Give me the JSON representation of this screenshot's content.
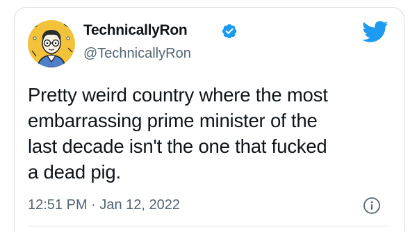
{
  "tweet": {
    "author": {
      "display_name": "TechnicallyRon",
      "handle": "@TechnicallyRon",
      "verified": true,
      "avatar_icon": "cartoon-avatar-icon"
    },
    "text_lines": [
      "Pretty weird country where the most",
      "embarrassing prime minister of the",
      "last decade isn't the one that fucked",
      "a dead pig."
    ],
    "timestamp": "12:51 PM · Jan 12, 2022"
  },
  "colors": {
    "text_primary": "#0f1419",
    "text_secondary": "#536471",
    "twitter_blue": "#1d9bf0",
    "border": "#d7dbe0",
    "avatar_background": "#f2c23a"
  },
  "icons": {
    "brand": "twitter-bird-icon",
    "verified": "verified-badge-icon",
    "info": "info-icon"
  }
}
